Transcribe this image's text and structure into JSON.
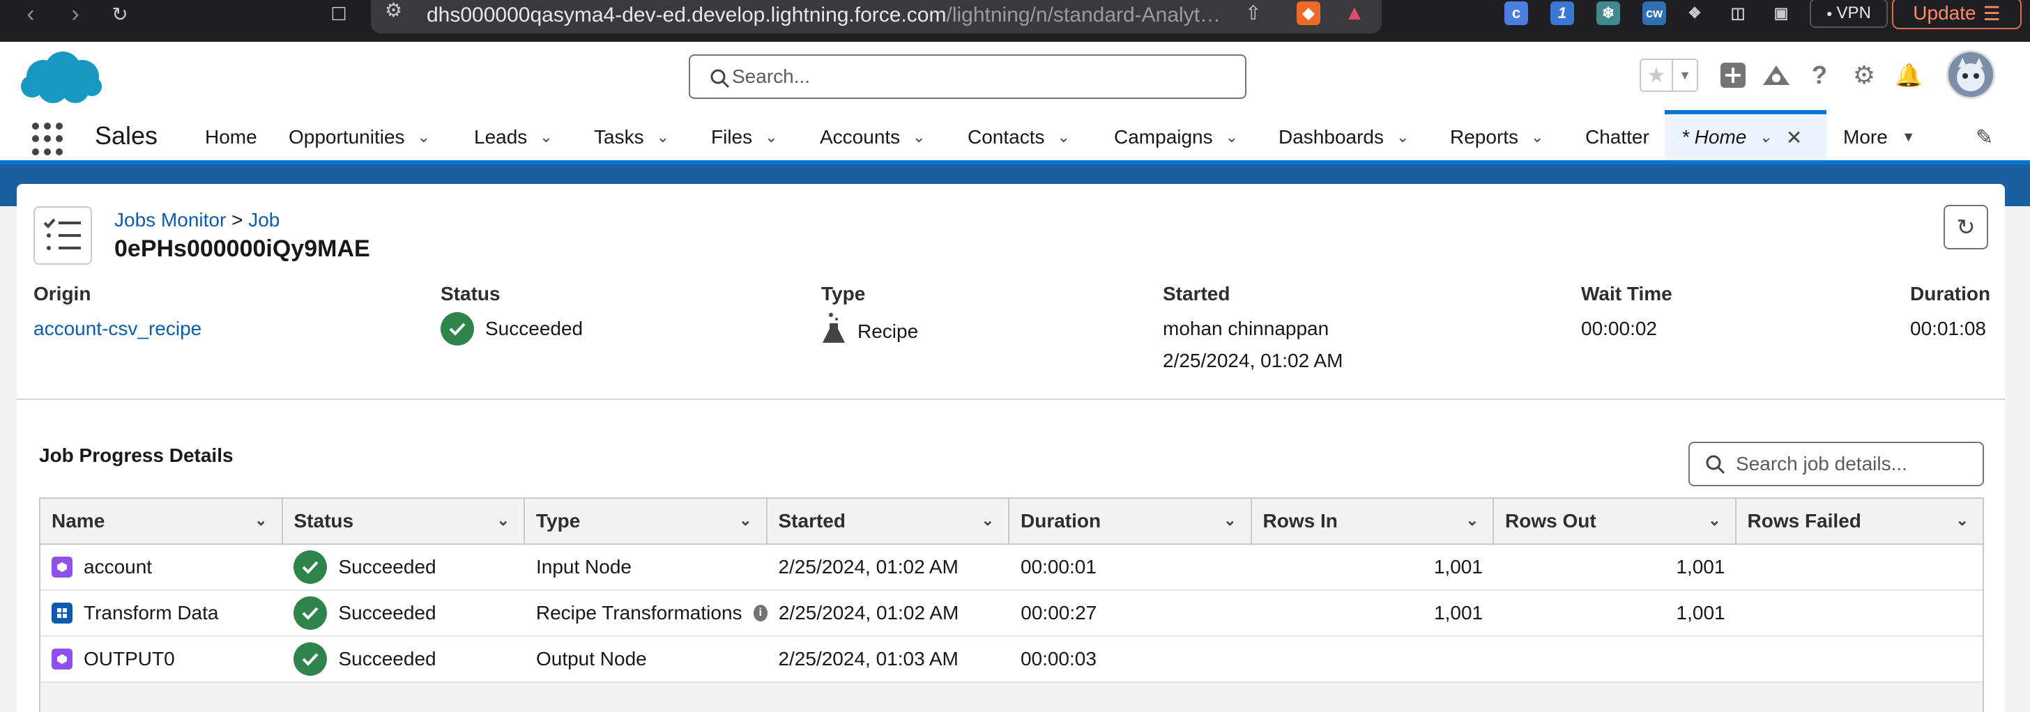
{
  "browser": {
    "url_main": "dhs000000qasyma4-dev-ed.develop.lightning.force.com",
    "url_path": "/lightning/n/standard-Analyt…",
    "vpn_label": "VPN",
    "update_label": "Update"
  },
  "header": {
    "search_placeholder": "Search..."
  },
  "app": {
    "name": "Sales",
    "nav": [
      {
        "label": "Home"
      },
      {
        "label": "Opportunities"
      },
      {
        "label": "Leads"
      },
      {
        "label": "Tasks"
      },
      {
        "label": "Files"
      },
      {
        "label": "Accounts"
      },
      {
        "label": "Contacts"
      },
      {
        "label": "Campaigns"
      },
      {
        "label": "Dashboards"
      },
      {
        "label": "Reports"
      },
      {
        "label": "Chatter"
      },
      {
        "label": "* Home"
      },
      {
        "label": "More"
      }
    ]
  },
  "job": {
    "breadcrumb_parent": "Jobs Monitor",
    "breadcrumb_sep": ">",
    "breadcrumb_current": "Job",
    "id": "0ePHs000000iQy9MAE",
    "fields": {
      "origin_label": "Origin",
      "origin_value": "account-csv_recipe",
      "status_label": "Status",
      "status_value": "Succeeded",
      "type_label": "Type",
      "type_value": "Recipe",
      "started_label": "Started",
      "started_by": "mohan chinnappan",
      "started_at": "2/25/2024, 01:02 AM",
      "wait_label": "Wait Time",
      "wait_value": "00:00:02",
      "duration_label": "Duration",
      "duration_value": "00:01:08"
    }
  },
  "progress": {
    "title": "Job Progress Details",
    "search_placeholder": "Search job details...",
    "columns": [
      "Name",
      "Status",
      "Type",
      "Started",
      "Duration",
      "Rows In",
      "Rows Out",
      "Rows Failed"
    ],
    "rows": [
      {
        "name": "account",
        "status": "Succeeded",
        "type": "Input Node",
        "started": "2/25/2024, 01:02 AM",
        "duration": "00:00:01",
        "rows_in": "1,001",
        "rows_out": "1,001",
        "rows_failed": ""
      },
      {
        "name": "Transform Data",
        "status": "Succeeded",
        "type": "Recipe Transformations",
        "started": "2/25/2024, 01:02 AM",
        "duration": "00:00:27",
        "rows_in": "1,001",
        "rows_out": "1,001",
        "rows_failed": ""
      },
      {
        "name": "OUTPUT0",
        "status": "Succeeded",
        "type": "Output Node",
        "started": "2/25/2024, 01:03 AM",
        "duration": "00:00:03",
        "rows_in": "",
        "rows_out": "",
        "rows_failed": ""
      }
    ]
  },
  "colors": {
    "brand_blue": "#0176d3",
    "link_blue": "#0b5cab",
    "success_green": "#2e844a",
    "band_blue": "#1b5f9e",
    "input_node_purple": "#9050e9",
    "transform_blue": "#0b5cab"
  }
}
